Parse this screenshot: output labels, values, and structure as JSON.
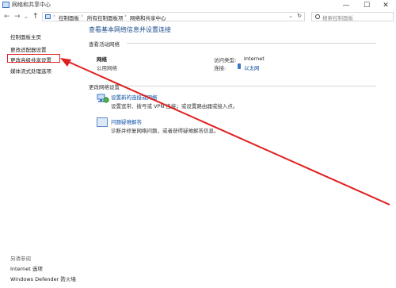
{
  "window": {
    "title": "网络和共享中心",
    "controls": {
      "minimize": "—",
      "maximize": "☐",
      "close": "✕"
    }
  },
  "navigation": {
    "back": "←",
    "forward": "→",
    "dropdown": "⌄",
    "up": "↑",
    "breadcrumbs": [
      "控制面板",
      "所有控制面板项",
      "网络和共享中心"
    ],
    "separator": "›",
    "refresh": "↻",
    "search_placeholder": "搜索控制面板"
  },
  "sidebar": {
    "items": [
      {
        "label": "控制面板主页"
      },
      {
        "label": "更改适配器设置"
      },
      {
        "label": "更改高级共享设置"
      },
      {
        "label": "媒体流式处理选项"
      }
    ],
    "see_also_label": "另请参阅",
    "see_also_items": [
      {
        "label": "Internet 选项"
      },
      {
        "label": "Windows Defender 防火墙"
      }
    ]
  },
  "main": {
    "title": "查看基本网络信息并设置连接",
    "active_networks_label": "查看活动网络",
    "network": {
      "name": "网络",
      "type": "公用网络",
      "access_type_label": "访问类型:",
      "access_type_value": "Internet",
      "connections_label": "连接:",
      "connections_value": "以太网"
    },
    "change_settings_label": "更改网络设置",
    "tasks": [
      {
        "link": "设置新的连接或网络",
        "desc": "设置宽带、拨号或 VPN 连接；或设置路由器或接入点。"
      },
      {
        "link": "问题疑难解答",
        "desc": "诊断并修复网络问题，或者获得疑难解答信息。"
      }
    ]
  },
  "colors": {
    "accent": "#0a4fa3",
    "annotation": "#e02020"
  },
  "icons": [
    "control-panel-icon",
    "search-icon",
    "network-setup-icon",
    "troubleshoot-icon",
    "ethernet-icon"
  ]
}
